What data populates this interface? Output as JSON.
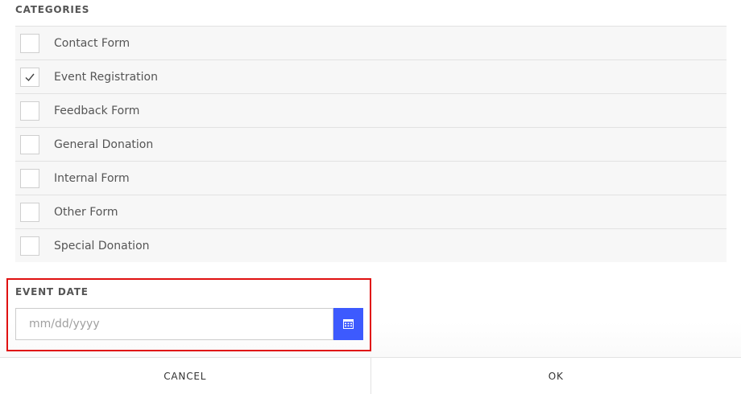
{
  "categories": {
    "label": "CATEGORIES",
    "items": [
      {
        "label": "Contact Form",
        "checked": false
      },
      {
        "label": "Event Registration",
        "checked": true
      },
      {
        "label": "Feedback Form",
        "checked": false
      },
      {
        "label": "General Donation",
        "checked": false
      },
      {
        "label": "Internal Form",
        "checked": false
      },
      {
        "label": "Other Form",
        "checked": false
      },
      {
        "label": "Special Donation",
        "checked": false
      }
    ]
  },
  "event_date": {
    "label": "EVENT DATE",
    "value": "",
    "placeholder": "mm/dd/yyyy",
    "button_icon": "calendar-icon"
  },
  "footer": {
    "cancel_label": "CANCEL",
    "ok_label": "OK"
  },
  "colors": {
    "accent": "#3d5afe",
    "highlight": "#e01010"
  }
}
